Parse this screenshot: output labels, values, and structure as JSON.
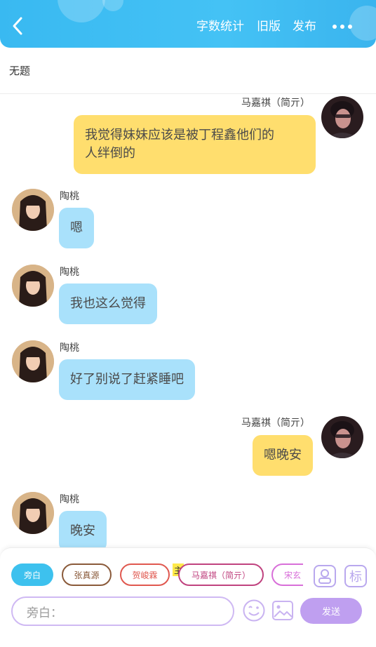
{
  "header": {
    "word_count_label": "字数统计",
    "old_version_label": "旧版",
    "publish_label": "发布"
  },
  "title": "无题",
  "messages": [
    {
      "speaker": "马嘉祺（简亓）",
      "side": "right",
      "text_lines": [
        "我觉得妹妹应该是被丁程鑫他们的",
        "人绊倒的"
      ]
    },
    {
      "speaker": "陶桃",
      "side": "left",
      "text_lines": [
        "嗯"
      ]
    },
    {
      "speaker": "陶桃",
      "side": "left",
      "text_lines": [
        "我也这么觉得"
      ]
    },
    {
      "speaker": "陶桃",
      "side": "left",
      "text_lines": [
        "好了别说了赶紧睡吧"
      ]
    },
    {
      "speaker": "马嘉祺（简亓）",
      "side": "right",
      "text_lines": [
        "嗯晚安"
      ]
    },
    {
      "speaker": "陶桃",
      "side": "left",
      "text_lines": [
        "晚安"
      ]
    }
  ],
  "roles": [
    {
      "label": "旁白",
      "color": "#3dc1ee",
      "selected": true
    },
    {
      "label": "张真源",
      "color": "#8a5a3a"
    },
    {
      "label": "贺峻霖",
      "color": "#e0584f"
    },
    {
      "label": "马嘉祺（简亓）",
      "color": "#c0437f"
    },
    {
      "label": "宋玄",
      "color": "#d86fd9"
    }
  ],
  "main_badge": "主",
  "tools": {
    "mark_label": "标"
  },
  "composer": {
    "placeholder": "旁白：",
    "send_label": "发送"
  },
  "colors": {
    "header": "#42bff4",
    "blue_bubble": "#a9e1fb",
    "yellow_bubble": "#ffde6e",
    "send": "#bf9ff0"
  }
}
